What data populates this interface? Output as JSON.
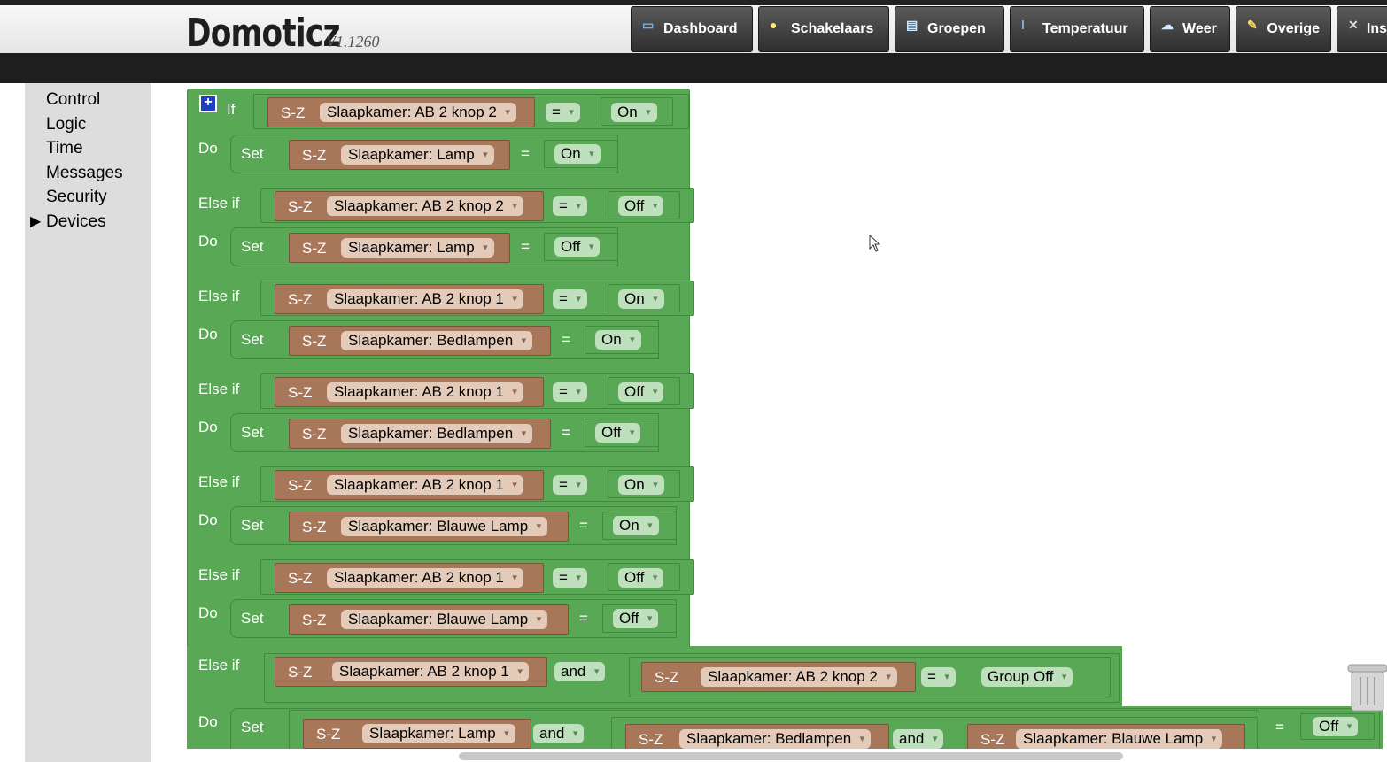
{
  "app": {
    "title": "Domoticz",
    "version": "V1.1260"
  },
  "nav": [
    {
      "label": "Dashboard",
      "icon": "monitor-icon"
    },
    {
      "label": "Schakelaars",
      "icon": "lightbulb-icon"
    },
    {
      "label": "Groepen",
      "icon": "group-icon"
    },
    {
      "label": "Temperatuur",
      "icon": "thermometer-icon"
    },
    {
      "label": "Weer",
      "icon": "weather-icon"
    },
    {
      "label": "Overige",
      "icon": "other-icon"
    },
    {
      "label": "Ins",
      "icon": "tools-icon"
    }
  ],
  "sidebar": {
    "items": [
      "Control",
      "Logic",
      "Time",
      "Messages",
      "Security",
      "Devices"
    ]
  },
  "blocks": {
    "if_label": "If",
    "do_label": "Do",
    "elseif_label": "Else if",
    "set_label": "Set",
    "prefix": "S-Z",
    "eq": "=",
    "and": "and",
    "rows": [
      {
        "kind": "if",
        "device": "Slaapkamer: AB 2 knop 2",
        "op": "=",
        "value": "On"
      },
      {
        "kind": "do",
        "device": "Slaapkamer: Lamp",
        "value": "On"
      },
      {
        "kind": "elseif",
        "device": "Slaapkamer: AB 2 knop 2",
        "op": "=",
        "value": "Off"
      },
      {
        "kind": "do",
        "device": "Slaapkamer: Lamp",
        "value": "Off"
      },
      {
        "kind": "elseif",
        "device": "Slaapkamer: AB 2 knop 1",
        "op": "=",
        "value": "On"
      },
      {
        "kind": "do",
        "device": "Slaapkamer: Bedlampen",
        "value": "On"
      },
      {
        "kind": "elseif",
        "device": "Slaapkamer: AB 2 knop 1",
        "op": "=",
        "value": "Off"
      },
      {
        "kind": "do",
        "device": "Slaapkamer: Bedlampen",
        "value": "Off"
      },
      {
        "kind": "elseif",
        "device": "Slaapkamer: AB 2 knop 1",
        "op": "=",
        "value": "On"
      },
      {
        "kind": "do",
        "device": "Slaapkamer: Blauwe Lamp",
        "value": "On"
      },
      {
        "kind": "elseif",
        "device": "Slaapkamer: AB 2 knop 1",
        "op": "=",
        "value": "Off"
      },
      {
        "kind": "do",
        "device": "Slaapkamer: Blauwe Lamp",
        "value": "Off"
      }
    ],
    "last_elseif": {
      "device1": "Slaapkamer: AB 2 knop 1",
      "logic": "and",
      "device2": "Slaapkamer: AB 2 knop 2",
      "op": "=",
      "value": "Group Off"
    },
    "last_do": {
      "device1": "Slaapkamer: Lamp",
      "logic1": "and",
      "device2": "Slaapkamer: Bedlampen",
      "logic2": "and",
      "device3": "Slaapkamer: Blauwe Lamp",
      "value": "Off"
    }
  },
  "colors": {
    "block_green": "#59a855",
    "device_brown": "#a8775a",
    "dropdown_tan": "#e4cbb9",
    "sidebar_gray": "#dddddd"
  }
}
